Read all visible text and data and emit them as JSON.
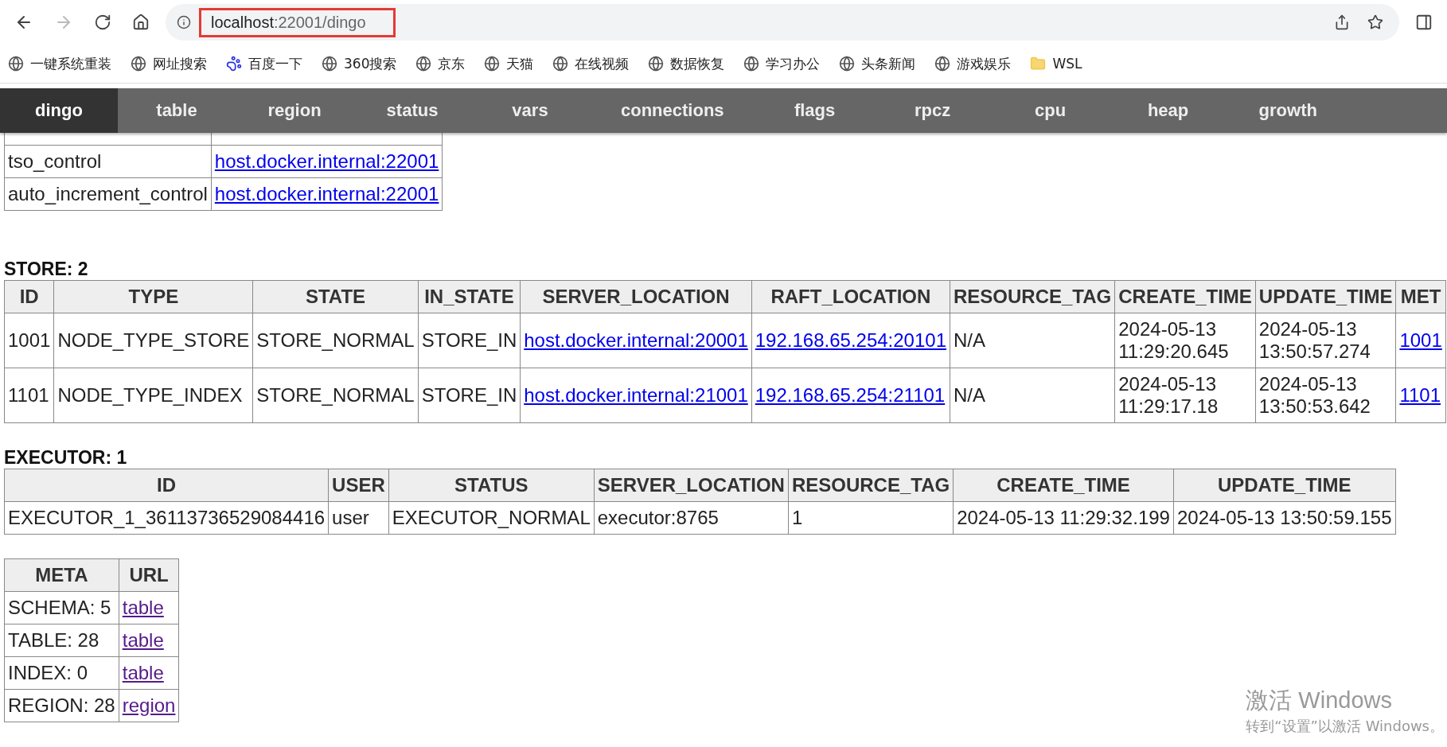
{
  "browser": {
    "back_disabled": false,
    "forward_disabled": true,
    "url_host": "localhost",
    "url_path": ":22001/dingo",
    "highlighted": true,
    "bookmarks": [
      {
        "label": "一键系统重装",
        "kind": "site"
      },
      {
        "label": "网址搜索",
        "kind": "site"
      },
      {
        "label": "百度一下",
        "kind": "paw"
      },
      {
        "label": "360搜索",
        "kind": "site"
      },
      {
        "label": "京东",
        "kind": "site"
      },
      {
        "label": "天猫",
        "kind": "site"
      },
      {
        "label": "在线视频",
        "kind": "site"
      },
      {
        "label": "数据恢复",
        "kind": "site"
      },
      {
        "label": "学习办公",
        "kind": "site"
      },
      {
        "label": "头条新闻",
        "kind": "site"
      },
      {
        "label": "游戏娱乐",
        "kind": "site"
      },
      {
        "label": "WSL",
        "kind": "folder"
      }
    ]
  },
  "nav": [
    {
      "label": "dingo",
      "selected": true
    },
    {
      "label": "table",
      "selected": false
    },
    {
      "label": "region",
      "selected": false
    },
    {
      "label": "status",
      "selected": false
    },
    {
      "label": "vars",
      "selected": false
    },
    {
      "label": "connections",
      "selected": false
    },
    {
      "label": "flags",
      "selected": false
    },
    {
      "label": "rpcz",
      "selected": false
    },
    {
      "label": "cpu",
      "selected": false
    },
    {
      "label": "heap",
      "selected": false
    },
    {
      "label": "growth",
      "selected": false
    }
  ],
  "control_table": {
    "rows": [
      [
        {
          "text": "tso_control",
          "kind": "text"
        },
        {
          "text": "host.docker.internal:22001",
          "kind": "link"
        }
      ],
      [
        {
          "text": "auto_increment_control",
          "kind": "text"
        },
        {
          "text": "host.docker.internal:22001",
          "kind": "link"
        }
      ]
    ]
  },
  "store": {
    "title": "STORE: 2",
    "columns": [
      "ID",
      "TYPE",
      "STATE",
      "IN_STATE",
      "SERVER_LOCATION",
      "RAFT_LOCATION",
      "RESOURCE_TAG",
      "CREATE_TIME",
      "UPDATE_TIME",
      "MET"
    ],
    "rows": [
      [
        {
          "text": "1001",
          "kind": "text"
        },
        {
          "text": "NODE_TYPE_STORE",
          "kind": "text"
        },
        {
          "text": "STORE_NORMAL",
          "kind": "text"
        },
        {
          "text": "STORE_IN",
          "kind": "text"
        },
        {
          "text": "host.docker.internal:20001",
          "kind": "link"
        },
        {
          "text": "192.168.65.254:20101",
          "kind": "link"
        },
        {
          "text": "N/A",
          "kind": "text"
        },
        {
          "text": "2024-05-13 11:29:20.645",
          "kind": "text"
        },
        {
          "text": "2024-05-13 13:50:57.274",
          "kind": "text"
        },
        {
          "text": "1001",
          "kind": "link"
        }
      ],
      [
        {
          "text": "1101",
          "kind": "text"
        },
        {
          "text": "NODE_TYPE_INDEX",
          "kind": "text"
        },
        {
          "text": "STORE_NORMAL",
          "kind": "text"
        },
        {
          "text": "STORE_IN",
          "kind": "text"
        },
        {
          "text": "host.docker.internal:21001",
          "kind": "link"
        },
        {
          "text": "192.168.65.254:21101",
          "kind": "link"
        },
        {
          "text": "N/A",
          "kind": "text"
        },
        {
          "text": "2024-05-13 11:29:17.18",
          "kind": "text"
        },
        {
          "text": "2024-05-13 13:50:53.642",
          "kind": "text"
        },
        {
          "text": "1101",
          "kind": "link"
        }
      ]
    ]
  },
  "executor": {
    "title": "EXECUTOR: 1",
    "columns": [
      "ID",
      "USER",
      "STATUS",
      "SERVER_LOCATION",
      "RESOURCE_TAG",
      "CREATE_TIME",
      "UPDATE_TIME"
    ],
    "rows": [
      [
        {
          "text": "EXECUTOR_1_36113736529084416",
          "kind": "text"
        },
        {
          "text": "user",
          "kind": "text"
        },
        {
          "text": "EXECUTOR_NORMAL",
          "kind": "text"
        },
        {
          "text": "executor:8765",
          "kind": "text"
        },
        {
          "text": "1",
          "kind": "text"
        },
        {
          "text": "2024-05-13 11:29:32.199",
          "kind": "text"
        },
        {
          "text": "2024-05-13 13:50:59.155",
          "kind": "text"
        }
      ]
    ]
  },
  "meta": {
    "columns": [
      "META",
      "URL"
    ],
    "rows": [
      [
        {
          "text": "SCHEMA: 5",
          "kind": "text"
        },
        {
          "text": "table",
          "kind": "visited_link"
        }
      ],
      [
        {
          "text": "TABLE: 28",
          "kind": "text"
        },
        {
          "text": "table",
          "kind": "visited_link"
        }
      ],
      [
        {
          "text": "INDEX: 0",
          "kind": "text"
        },
        {
          "text": "table",
          "kind": "visited_link"
        }
      ],
      [
        {
          "text": "REGION: 28",
          "kind": "text"
        },
        {
          "text": "region",
          "kind": "visited_link"
        }
      ]
    ]
  },
  "os_notice": {
    "title": "激活 Windows",
    "subtitle": "转到“设置”以激活 Windows。"
  }
}
